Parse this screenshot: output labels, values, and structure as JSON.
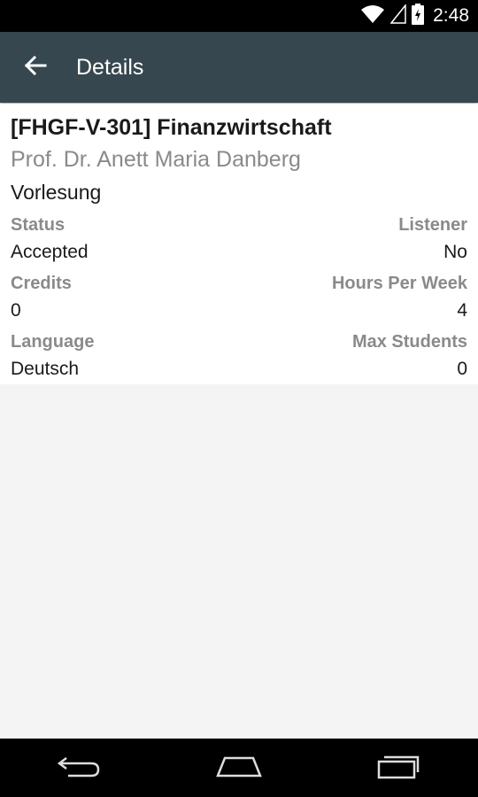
{
  "status_bar": {
    "time": "2:48",
    "icons": [
      "wifi-icon",
      "cell-signal-icon",
      "battery-icon"
    ]
  },
  "app_bar": {
    "title": "Details",
    "back_icon": "arrow-back-icon",
    "background": "#37474f"
  },
  "course": {
    "title": "[FHGF-V-301] Finanzwirtschaft",
    "professor": "Prof. Dr. Anett Maria Danberg",
    "type": "Vorlesung"
  },
  "fields": {
    "status_label": "Status",
    "status_value": "Accepted",
    "listener_label": "Listener",
    "listener_value": "No",
    "credits_label": "Credits",
    "credits_value": "0",
    "hours_label": "Hours Per Week",
    "hours_value": "4",
    "language_label": "Language",
    "language_value": "Deutsch",
    "max_students_label": "Max Students",
    "max_students_value": "0"
  },
  "nav_bar": {
    "icons": [
      "back-nav-icon",
      "home-nav-icon",
      "recents-nav-icon"
    ]
  }
}
